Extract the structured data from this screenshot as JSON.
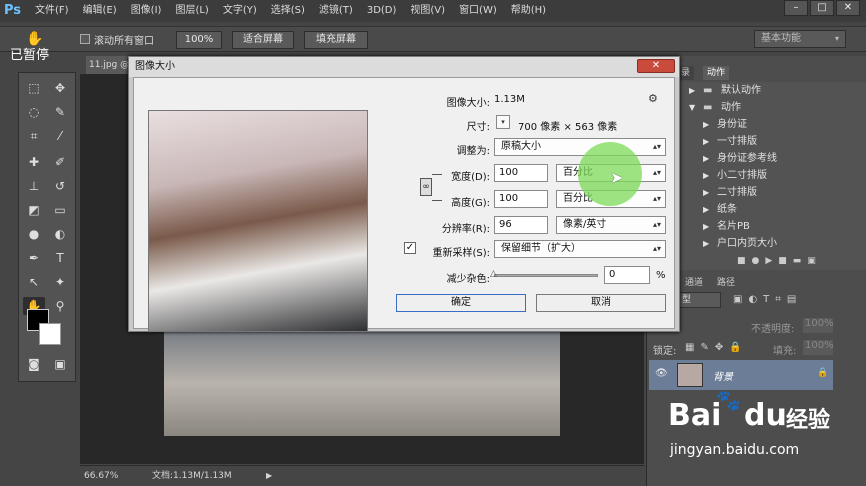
{
  "app": {
    "logo": "Ps",
    "paused_label": "已暂停"
  },
  "menu": [
    "文件(F)",
    "编辑(E)",
    "图像(I)",
    "图层(L)",
    "文字(Y)",
    "选择(S)",
    "滤镜(T)",
    "3D(D)",
    "视图(V)",
    "窗口(W)",
    "帮助(H)"
  ],
  "window_controls": {
    "minimize": "–",
    "maximize": "□",
    "close": "✕"
  },
  "options_bar": {
    "scroll_all": "滚动所有窗口",
    "zoom_100": "100%",
    "fit_screen": "适合屏幕",
    "fill_screen": "填充屏幕"
  },
  "workspace": {
    "label": "基本功能"
  },
  "document": {
    "tab": "11.jpg @",
    "zoom": "66.67%",
    "doc_info": "文档:1.13M/1.13M"
  },
  "dialog": {
    "title": "图像大小",
    "image_size_label": "图像大小:",
    "image_size_value": "1.13M",
    "dimensions_label": "尺寸:",
    "dimensions_value": "700 像素 × 563 像素",
    "fit_to_label": "调整为:",
    "fit_to_value": "原稿大小",
    "width_label": "宽度(D):",
    "width_value": "100",
    "width_unit": "百分比",
    "height_label": "高度(G):",
    "height_value": "100",
    "height_unit": "百分比",
    "resolution_label": "分辨率(R):",
    "resolution_value": "96",
    "resolution_unit": "像素/英寸",
    "resample_label": "重新采样(S):",
    "resample_value": "保留细节（扩大）",
    "reduce_noise_label": "减少杂色:",
    "reduce_noise_value": "0",
    "reduce_noise_unit": "%",
    "ok": "确定",
    "cancel": "取消"
  },
  "panels": {
    "actions_tabs": [
      "录",
      "动作"
    ],
    "actions": [
      {
        "label": "默认动作",
        "type": "folder"
      },
      {
        "label": "动作",
        "type": "folder"
      },
      {
        "label": "身份证",
        "type": "item"
      },
      {
        "label": "一寸排版",
        "type": "item"
      },
      {
        "label": "身份证参考线",
        "type": "item"
      },
      {
        "label": "小二寸排版",
        "type": "item"
      },
      {
        "label": "二寸排版",
        "type": "item"
      },
      {
        "label": "纸条",
        "type": "item"
      },
      {
        "label": "名片PB",
        "type": "item"
      },
      {
        "label": "户口内页大小",
        "type": "item"
      }
    ],
    "layers_tabs": [
      "通道",
      "路径"
    ],
    "kind_label": "型",
    "opacity_label": "不透明度:",
    "opacity_value": "100%",
    "lock_label": "锁定:",
    "fill_label": "填充:",
    "fill_value": "100%",
    "layer_name": "背景"
  },
  "watermark": {
    "brand": "Bai",
    "brand2": "du",
    "brand_cn": "经验",
    "url": "jingyan.baidu.com"
  },
  "colors": {
    "accent": "#6ec1ff",
    "highlight": "#7ed957",
    "dialog_bg": "#f0f0f0"
  }
}
